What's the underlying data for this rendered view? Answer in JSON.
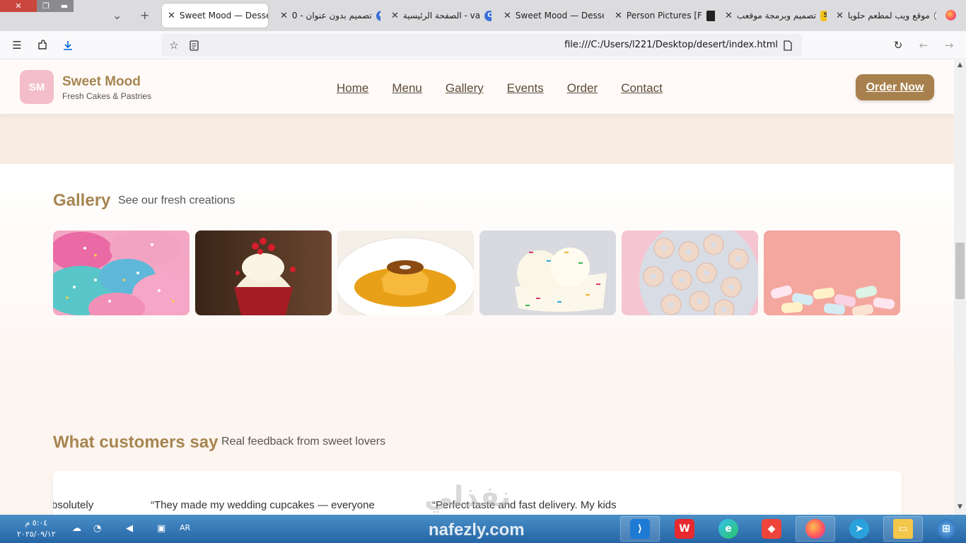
{
  "browser": {
    "tabs": [
      {
        "title": "Sweet Mood — Desse",
        "active": true
      },
      {
        "title": "تصميم بدون عنوان - 0",
        "icon": "canva-icon"
      },
      {
        "title": "الصفحة الرئيسية - va",
        "icon": "canva-icon"
      },
      {
        "title": "Sweet Mood — Desse"
      },
      {
        "title": "Person Pictures [F",
        "icon": "unsplash-icon"
      },
      {
        "title": "تصميم وبرمجة موقعب",
        "icon": "nafezly-icon",
        "badge": "5"
      },
      {
        "title": "موقع ويب لمطعم حلويا",
        "icon": "chatgpt-icon"
      }
    ],
    "url": "file:///C:/Users/l221/Desktop/desert/index.html"
  },
  "site": {
    "logo_initials": "SM",
    "brand_name": "Sweet Mood",
    "tagline": "Fresh Cakes & Pastries",
    "nav": [
      "Home",
      "Menu",
      "Gallery",
      "Events",
      "Order",
      "Contact"
    ],
    "cta": "Order Now"
  },
  "gallery": {
    "title": "Gallery",
    "subtitle": "See our fresh creations",
    "images": [
      "donuts",
      "red-velvet-cupcake",
      "flan",
      "ice-cream",
      "sprinkle-donut-cookies",
      "marshmallows"
    ]
  },
  "reviews": {
    "title": "What customers say",
    "subtitle": "Real feedback from sweet lovers",
    "quotes": [
      "bsolutely",
      "“They made my wedding cupcakes — everyone",
      "“Perfect taste and fast delivery. My kids"
    ]
  },
  "taskbar": {
    "time": "٥:٠٤ م",
    "date": "٢٠٢٥/٠٩/١٢",
    "language": "AR",
    "brand_watermark": "nafezly.com",
    "brand_watermark_ar": "نفذلي"
  },
  "colors": {
    "accent": "#a68550",
    "button": "#a8804d",
    "logo_bg": "#f3bdc9",
    "taskbar": "#2565a5"
  }
}
